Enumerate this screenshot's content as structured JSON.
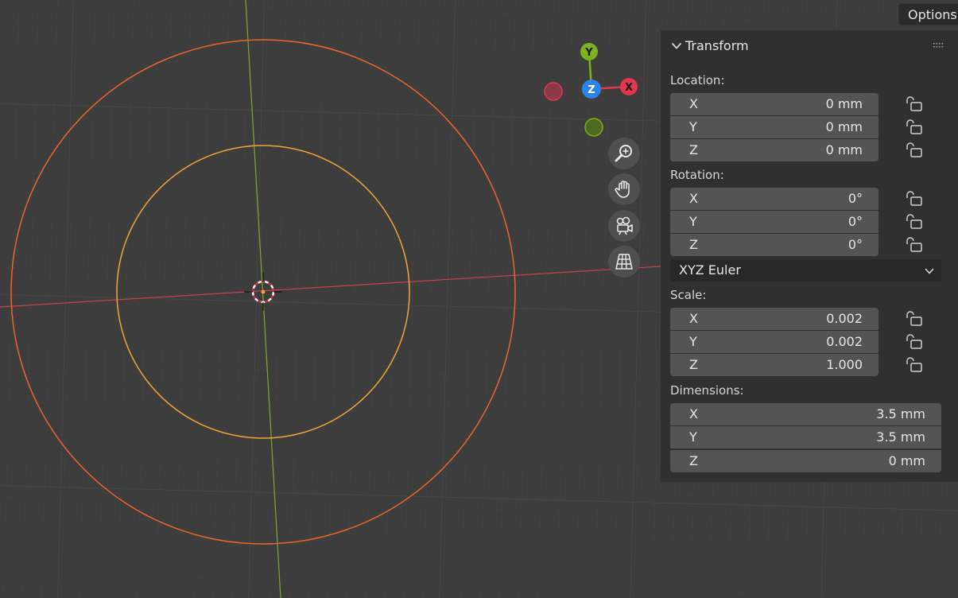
{
  "header": {
    "options_label": "Options"
  },
  "gizmo": {
    "y_label": "Y",
    "z_label": "Z",
    "x_label": "X"
  },
  "nav": {
    "icons": [
      "zoom-icon",
      "hand-pan-icon",
      "camera-icon",
      "perspective-grid-icon"
    ]
  },
  "panel": {
    "title": "Transform",
    "location": {
      "label": "Location:",
      "fields": [
        {
          "axis": "X",
          "value": "0 mm"
        },
        {
          "axis": "Y",
          "value": "0 mm"
        },
        {
          "axis": "Z",
          "value": "0 mm"
        }
      ]
    },
    "rotation": {
      "label": "Rotation:",
      "fields": [
        {
          "axis": "X",
          "value": "0°"
        },
        {
          "axis": "Y",
          "value": "0°"
        },
        {
          "axis": "Z",
          "value": "0°"
        }
      ],
      "mode": "XYZ Euler"
    },
    "scale": {
      "label": "Scale:",
      "fields": [
        {
          "axis": "X",
          "value": "0.002"
        },
        {
          "axis": "Y",
          "value": "0.002"
        },
        {
          "axis": "Z",
          "value": "1.000"
        }
      ]
    },
    "dimensions": {
      "label": "Dimensions:",
      "fields": [
        {
          "axis": "X",
          "value": "3.5 mm"
        },
        {
          "axis": "Y",
          "value": "3.5 mm"
        },
        {
          "axis": "Z",
          "value": "0 mm"
        }
      ]
    }
  },
  "colors": {
    "outer_circle": "#e8652a",
    "inner_circle": "#f2a33a",
    "x_axis": "#c8424e",
    "y_axis": "#7ea82e",
    "gizmo_x": "#e2384f",
    "gizmo_y": "#7bb21e",
    "gizmo_z": "#2f83e6"
  }
}
